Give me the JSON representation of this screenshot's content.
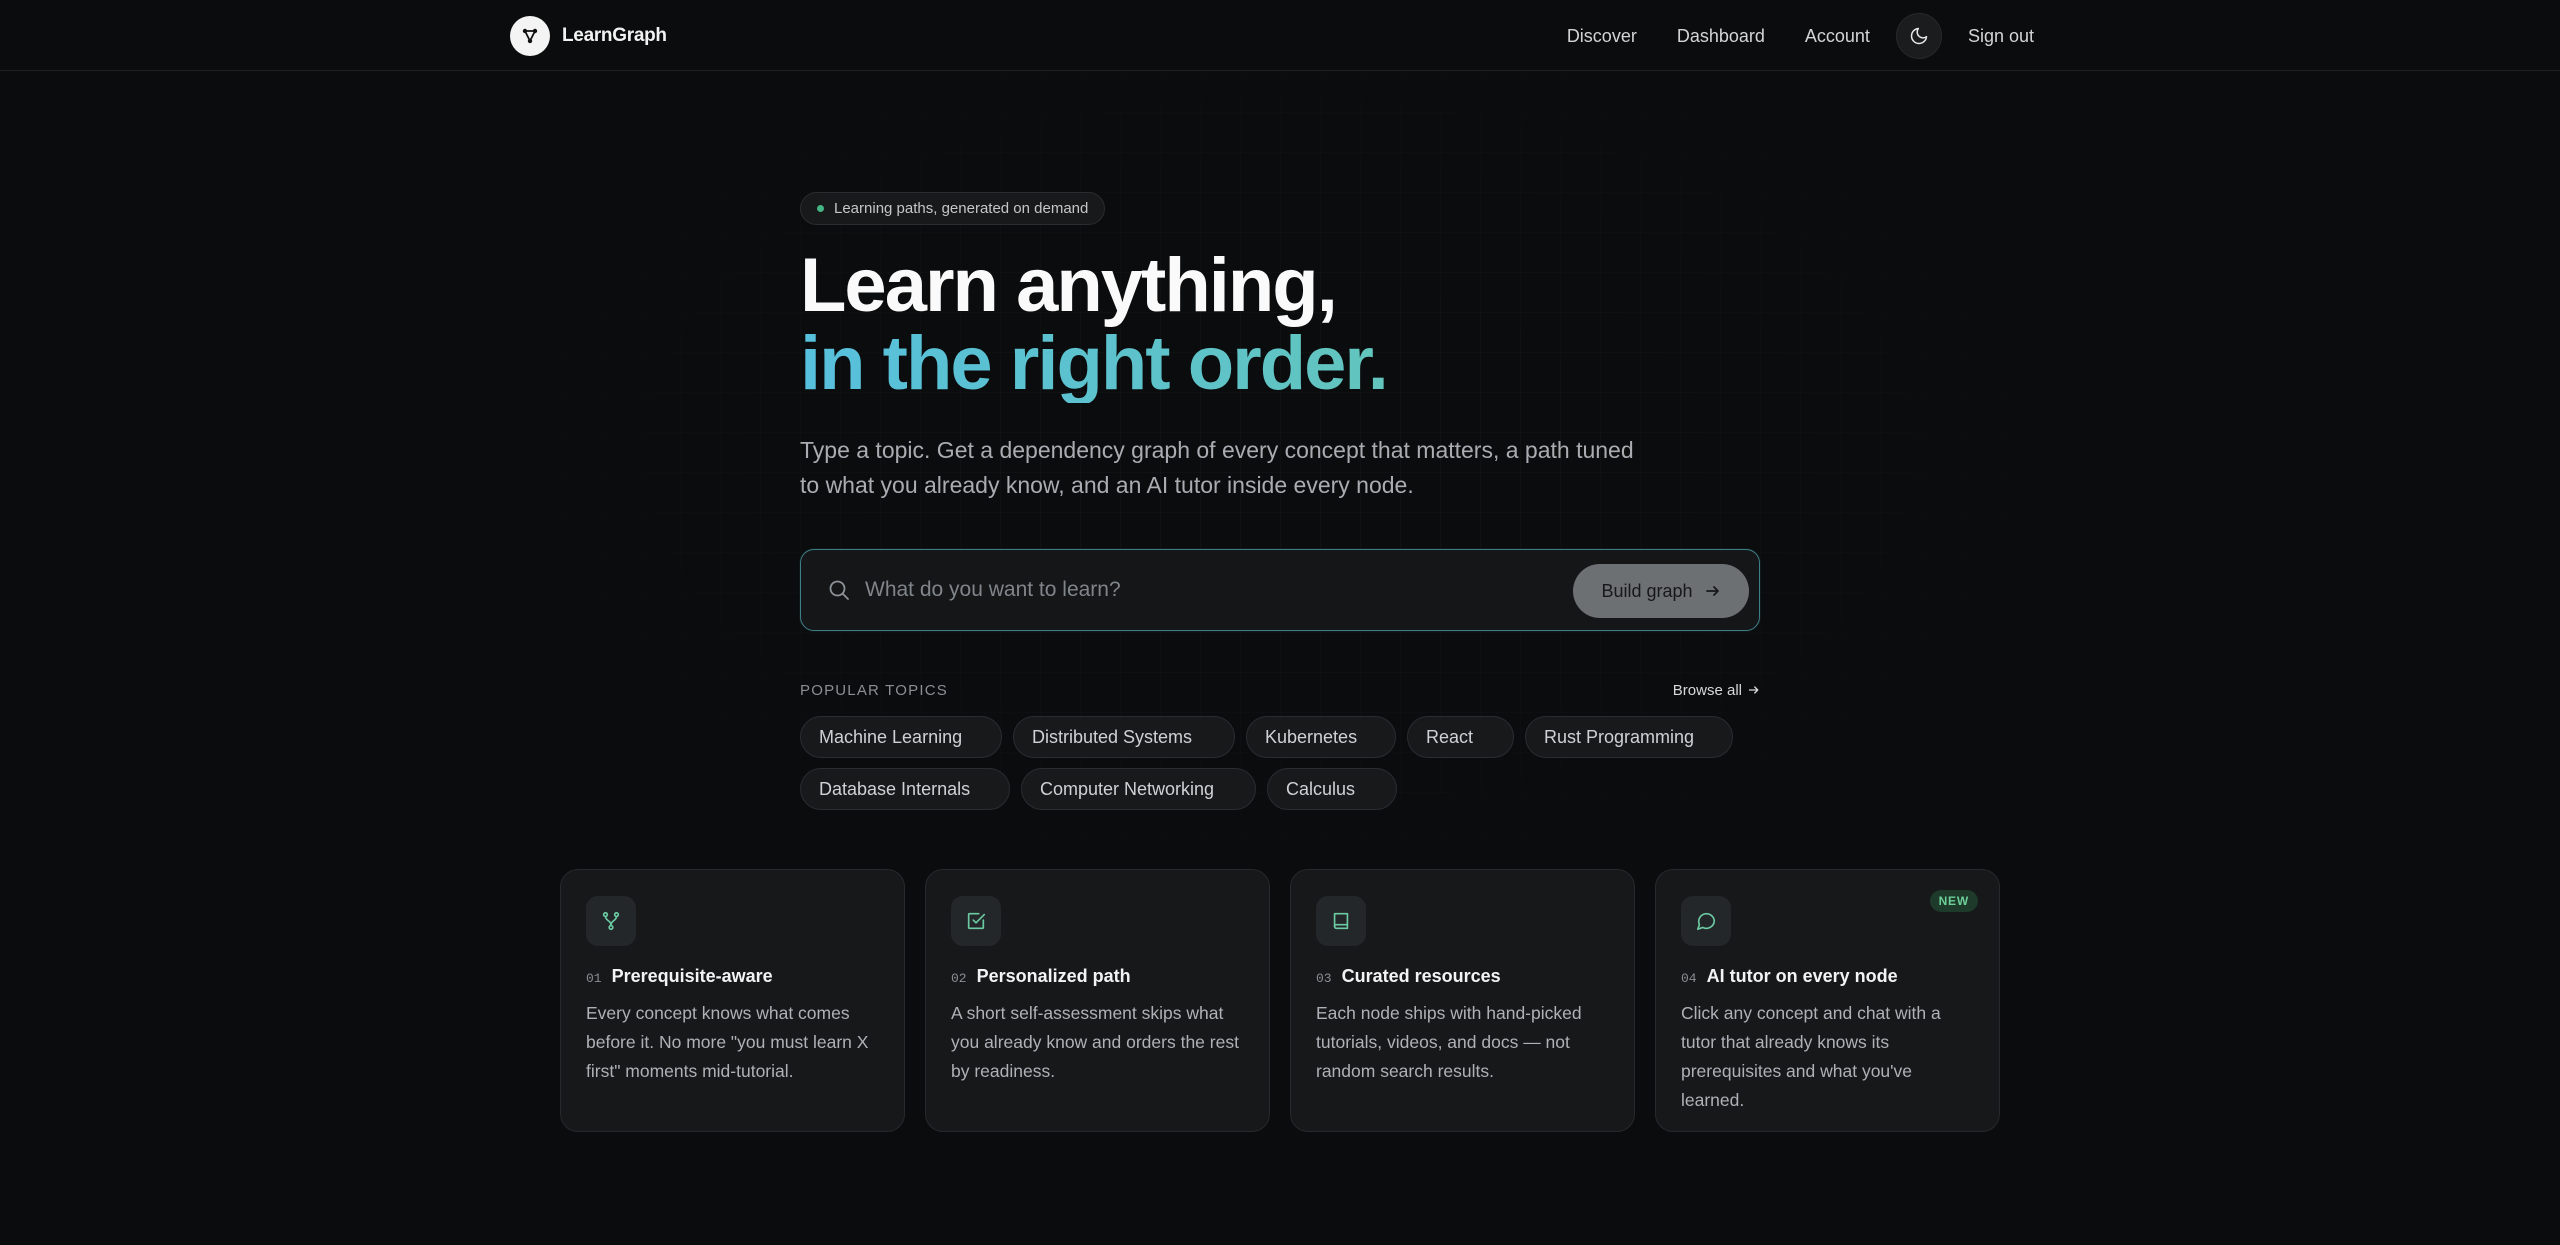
{
  "app": {
    "name": "LearnGraph",
    "logo_icon": "graph-logo-icon"
  },
  "nav": {
    "links": [
      "Discover",
      "Dashboard",
      "Account"
    ],
    "theme_toggle_icon": "moon-icon",
    "sign_out": "Sign out"
  },
  "hero": {
    "pill": "Learning paths, generated on demand",
    "title_line1": "Learn anything,",
    "title_line2": "in the right order.",
    "subtitle": "Type a topic. Get a dependency graph of every concept that matters, a path tuned to what you already know, and an AI tutor inside every node."
  },
  "search": {
    "placeholder": "What do you want to learn?",
    "value": "",
    "button_label": "Build graph"
  },
  "topics": {
    "label": "POPULAR TOPICS",
    "browse_all": "Browse all",
    "items": [
      "Machine Learning",
      "Distributed Systems",
      "Kubernetes",
      "React",
      "Rust Programming",
      "Database Internals",
      "Computer Networking",
      "Calculus"
    ]
  },
  "features": [
    {
      "num": "01",
      "title": "Prerequisite-aware",
      "desc": "Every concept knows what comes before it. No more \"you must learn X first\" moments mid-tutorial.",
      "icon": "git-fork-icon"
    },
    {
      "num": "02",
      "title": "Personalized path",
      "desc": "A short self-assessment skips what you already know and orders the rest by readiness.",
      "icon": "checkbox-icon"
    },
    {
      "num": "03",
      "title": "Curated resources",
      "desc": "Each node ships with hand-picked tutorials, videos, and docs — not random search results.",
      "icon": "book-icon"
    },
    {
      "num": "04",
      "title": "AI tutor on every node",
      "desc": "Click any concept and chat with a tutor that already knows its prerequisites and what you've learned.",
      "icon": "chat-bubble-icon",
      "badge": "NEW"
    }
  ],
  "colors": {
    "accent_teal": "#57c0dc",
    "accent_green": "#6ccaa3",
    "background": "#0b0c0d"
  }
}
